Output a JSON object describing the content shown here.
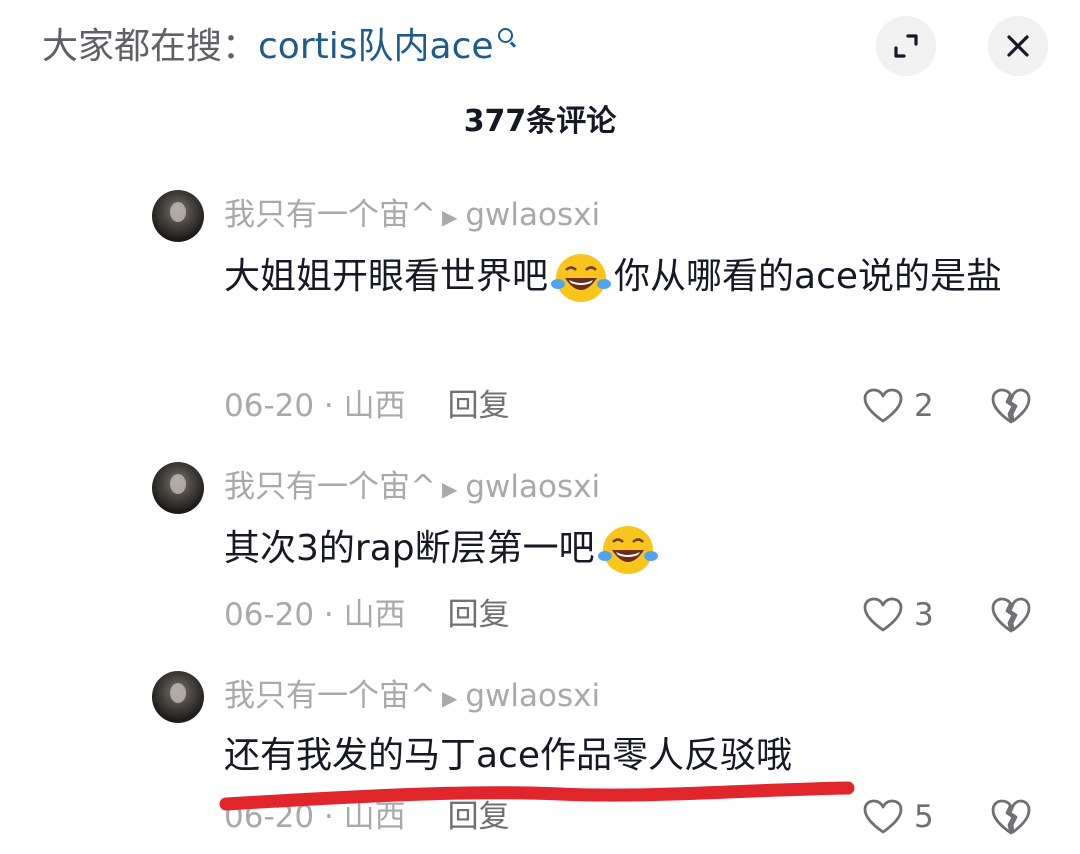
{
  "header": {
    "search_prefix": "大家都在搜：",
    "search_term": "cortis队内ace",
    "comment_count_label": "377条评论"
  },
  "comments": [
    {
      "author": "我只有一个宙^",
      "reply_to": "gwlaosxi",
      "text_part1": "大姐姐开眼看世界吧",
      "text_part2": "你从哪看的ace说的是盐",
      "date_location": "06-20 · 山西",
      "reply_label": "回复",
      "likes": "2"
    },
    {
      "author": "我只有一个宙^",
      "reply_to": "gwlaosxi",
      "text_part1": "其次3的rap断层第一吧",
      "date_location": "06-20 · 山西",
      "reply_label": "回复",
      "likes": "3"
    },
    {
      "author": "我只有一个宙^",
      "reply_to": "gwlaosxi",
      "text_part1": "还有我发的马丁ace作品零人反驳哦",
      "date_location": "06-20 · 山西",
      "reply_label": "回复",
      "likes": "5"
    }
  ],
  "icons": {
    "expand": "expand-icon",
    "close": "close-icon",
    "like": "heart-outline-icon",
    "dislike": "broken-heart-icon",
    "emoji": "tears-of-joy-emoji"
  },
  "colors": {
    "search_term": "#1f5a8c",
    "annotation_underline": "#e0262b"
  }
}
